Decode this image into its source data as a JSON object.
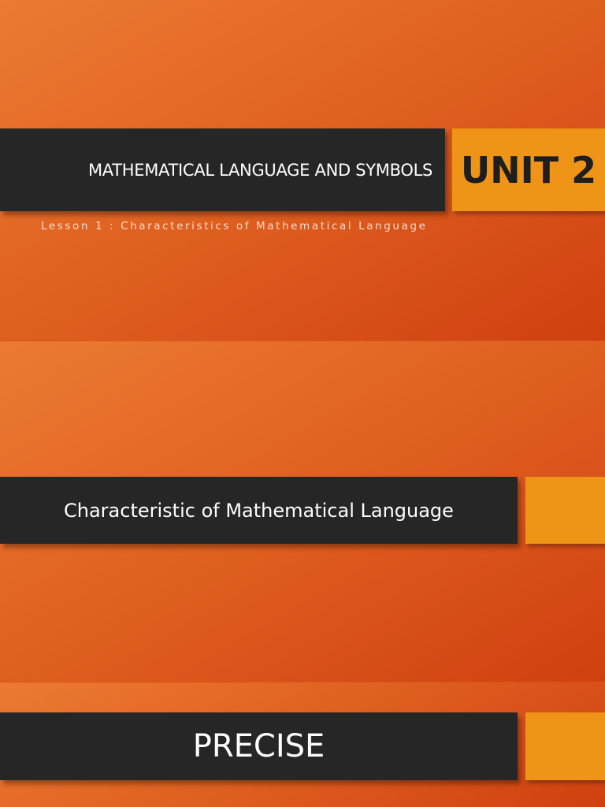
{
  "slides": [
    {
      "title": "MATHEMATICAL LANGUAGE AND SYMBOLS",
      "unit": "UNIT 2",
      "subtitle": "Lesson 1 : Characteristics of Mathematical Language"
    },
    {
      "title": "Characteristic of Mathematical Language"
    },
    {
      "title": "PRECISE"
    }
  ],
  "colors": {
    "accent": "#f09418",
    "bar": "#262626",
    "background": "#df5f20"
  }
}
